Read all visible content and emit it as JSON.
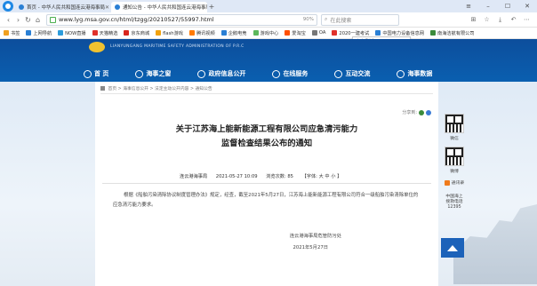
{
  "browser": {
    "tabs": [
      {
        "label": "首页 - 中华人民共和国连云港海事局",
        "active": false
      },
      {
        "label": "通知公告 - 中华人民共和国连云港海事局",
        "active": true
      }
    ],
    "new_tab": "+",
    "url": "www.lyg.msa.gov.cn/html/tzgg/20210527/55997.html",
    "zoom": "90%",
    "search_placeholder": "在此搜索",
    "suggestion": "如何赚钱"
  },
  "bookmarks": [
    {
      "label": "书签",
      "color": "#f0a020"
    },
    {
      "label": "上网导航",
      "color": "#2a7fd4"
    },
    {
      "label": "NOW直播",
      "color": "#2d9cdb"
    },
    {
      "label": "天猫精选",
      "color": "#e0302a"
    },
    {
      "label": "京东商城",
      "color": "#d9251d"
    },
    {
      "label": "flash游戏",
      "color": "#f2a20e"
    },
    {
      "label": "腾讯视频",
      "color": "#ff7a00"
    },
    {
      "label": "企鹅电竞",
      "color": "#2a7fd4"
    },
    {
      "label": "游戏中心",
      "color": "#5cb85c"
    },
    {
      "label": "爱淘宝",
      "color": "#ff5000"
    },
    {
      "label": "OA",
      "color": "#777777"
    },
    {
      "label": "2020一建考试",
      "color": "#e0302a"
    },
    {
      "label": "中国电力设备信息网",
      "color": "#2a7fd4"
    },
    {
      "label": "南海洁航有限公司",
      "color": "#3b8b3b"
    }
  ],
  "site": {
    "en_name": "LIANYUNGANG MARITIME SAFETY ADMINISTRATION OF P.R.C",
    "nav": [
      "首 页",
      "海事之窗",
      "政府信息公开",
      "在线服务",
      "互动交流",
      "海事数据"
    ]
  },
  "breadcrumb": "首页 > 海事信息公开 > 法定主动公开内容 > 通知公告",
  "share_label": "分享到:",
  "article": {
    "title_line1": "关于江苏海上能新能源工程有限公司应急清污能力",
    "title_line2": "监督检查结果公布的通知",
    "source": "连云港海事局",
    "date": "2021-05-27 10:09",
    "views": "浏览次数: 85",
    "font_size": "【字体: 大  中  小 】",
    "body": "根据《船舶污染清除协议制度管理办法》规定，经查，截至2021年5月27日，江苏海上能新能源工程有限公司符合一级船舶污染清除单位的应急清污能力要求。",
    "sign_org": "连云港海事局危管防污处",
    "sign_date": "2021年5月27日"
  },
  "sidebar": {
    "qr1_label": "微信",
    "qr2_label": "微博",
    "rss_label": "通讯录",
    "hotline": [
      "中国海上",
      "搜救电话",
      "12395"
    ]
  }
}
